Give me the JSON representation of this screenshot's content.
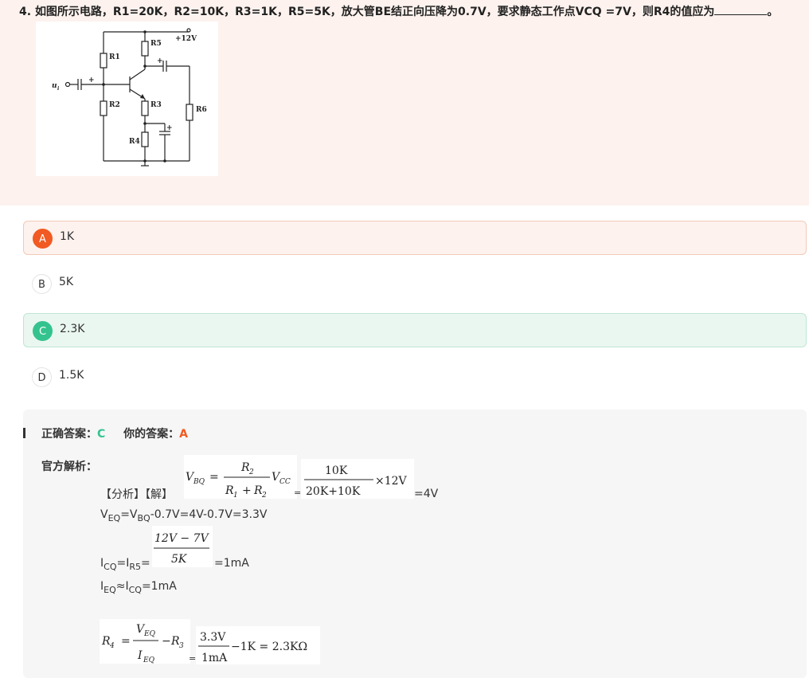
{
  "question": {
    "number": "4.",
    "text": "如图所示电路，R1=20K，R2=10K，R3=1K，R5=5K，放大管BE结正向压降为0.7V，要求静态工作点VCQ =7V，则R4的值应为",
    "suffix": "。",
    "circuit": {
      "labels": {
        "vcc": "+12V",
        "input": "u",
        "input_sub": "i",
        "r1": "R1",
        "r2": "R2",
        "r3": "R3",
        "r4": "R4",
        "r5": "R5",
        "r6": "R6",
        "plus": "+"
      }
    }
  },
  "options": [
    {
      "letter": "A",
      "text": "1K",
      "state": "selected-wrong"
    },
    {
      "letter": "B",
      "text": "5K",
      "state": "none"
    },
    {
      "letter": "C",
      "text": "2.3K",
      "state": "correct"
    },
    {
      "letter": "D",
      "text": "1.5K",
      "state": "none"
    }
  ],
  "analysis": {
    "correct_label": "正确答案：",
    "correct_value": "C",
    "your_label": "你的答案：",
    "your_value": "A",
    "official_label": "官方解析：",
    "line1_prefix": "【分析】【解】",
    "line1_suffix": "=4V",
    "line2": {
      "a": "V",
      "a_sub": "EQ",
      "b": "=V",
      "b_sub": "BQ",
      "c": "-0.7V=4V-0.7V=3.3V"
    },
    "line3": {
      "a": "I",
      "a_sub": "CQ",
      "b": "=I",
      "b_sub": "R5",
      "c": "=",
      "suffix": "=1mA"
    },
    "line4": {
      "a": "I",
      "a_sub": "EQ",
      "b": "≈I",
      "b_sub": "CQ",
      "c": "=1mA"
    },
    "f1": {
      "lhs": "V",
      "lhs_sub": "BQ",
      "eq": "=",
      "num": "R",
      "num_sub": "2",
      "den_a": "R",
      "den_a_sub": "1",
      "den_plus": "+",
      "den_b": "R",
      "den_b_sub": "2",
      "rhs": "V",
      "rhs_sub": "CC"
    },
    "f2": {
      "num": "10K",
      "den": "20K+10K",
      "times": "×12V",
      "eq": "="
    },
    "f3": {
      "num": "12V − 7V",
      "den": "5K"
    },
    "f4": {
      "lhs": "R",
      "lhs_sub": "4",
      "eq": "=",
      "num": "V",
      "num_sub": "EQ",
      "den": "I",
      "den_sub": "EQ",
      "minus": "−",
      "r3": "R",
      "r3_sub": "3"
    },
    "f5": {
      "num": "3.3V",
      "den": "1mA",
      "rest": "−1K = 2.3KΩ",
      "eq": "="
    }
  },
  "colors": {
    "accent_wrong": "#f15a22",
    "accent_correct": "#34c38f",
    "question_bg": "#fdf2ee"
  }
}
